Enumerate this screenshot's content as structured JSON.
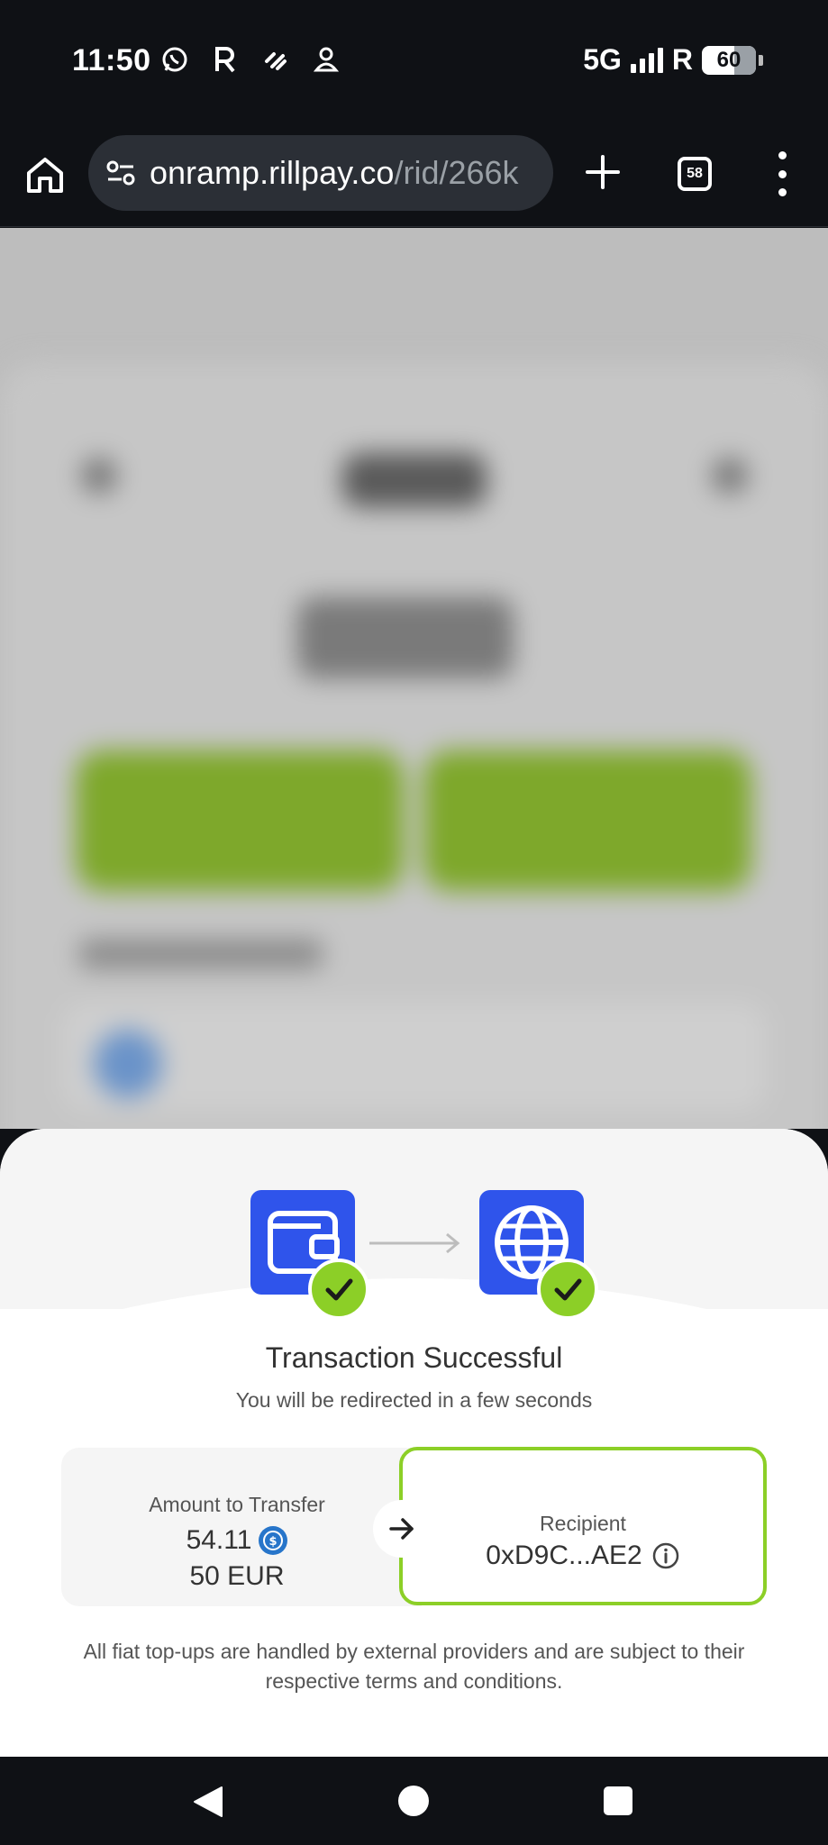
{
  "status_bar": {
    "time": "11:50",
    "network": "5G",
    "roaming": "R",
    "notification_icons": [
      "whatsapp-icon",
      "r-app-icon",
      "tv-icon",
      "user-pin-icon"
    ],
    "battery": "60"
  },
  "browser": {
    "url_host": "onramp.rillpay.co",
    "url_path": "/rid/266k",
    "tab_count": "58"
  },
  "sheet": {
    "title": "Transaction Successful",
    "subtitle": "You will be redirected in a few seconds",
    "amount_label": "Amount to Transfer",
    "amount_value": "54.11",
    "amount_fiat": "50 EUR",
    "recipient_label": "Recipient",
    "recipient_value": "0xD9C...AE2",
    "disclaimer": "All fiat top-ups are handled by external providers and are subject to their respective terms and conditions."
  },
  "colors": {
    "accent_blue": "#2f54eb",
    "success_green": "#8ccf27",
    "usdc_blue": "#2775ca",
    "dark_bg": "#0f1115"
  }
}
